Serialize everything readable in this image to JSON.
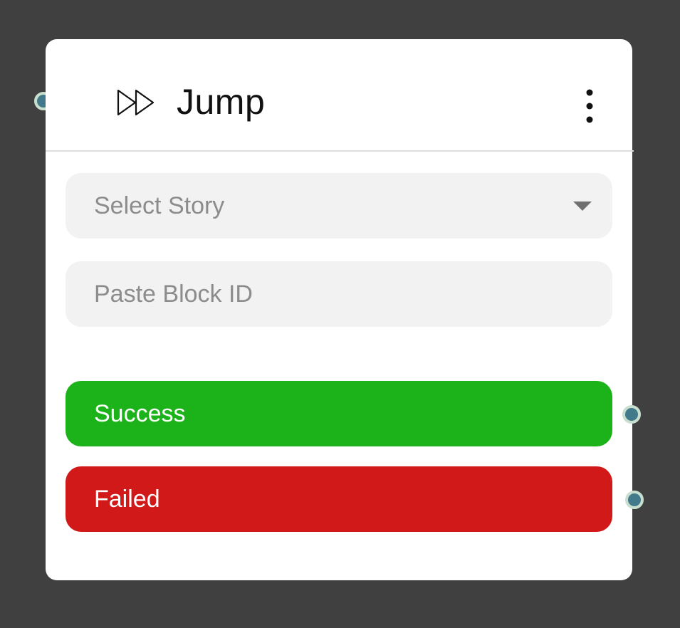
{
  "node": {
    "title": "Jump",
    "icon": "fast-forward-icon",
    "menu_icon": "more-vertical-icon"
  },
  "fields": {
    "story_select": {
      "placeholder": "Select Story",
      "icon": "chevron-down-icon"
    },
    "block_id": {
      "placeholder": "Paste Block ID"
    }
  },
  "outcomes": {
    "success": {
      "label": "Success",
      "color": "#1cb31a"
    },
    "failed": {
      "label": "Failed",
      "color": "#d11919"
    }
  },
  "colors": {
    "canvas_background": "#404040",
    "card_background": "#ffffff",
    "port_fill": "#437a8b",
    "port_ring": "#c8dfcf",
    "field_background": "#f2f2f2"
  }
}
